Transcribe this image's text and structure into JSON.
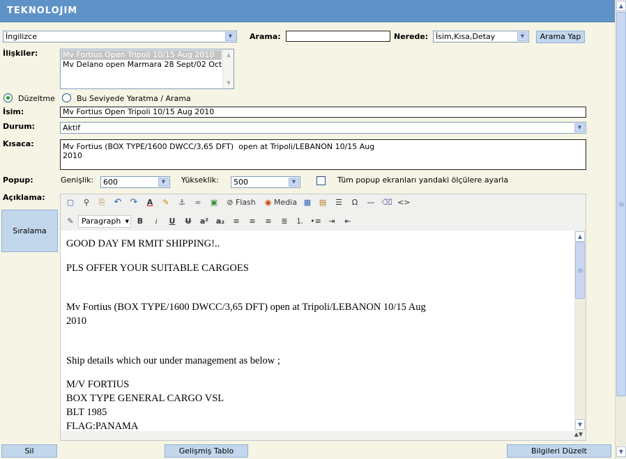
{
  "header": {
    "logo": "TEKNOLOJIM"
  },
  "search": {
    "language_value": "İngilizce",
    "arama_label": "Arama:",
    "arama_value": "",
    "nerede_label": "Nerede:",
    "nerede_value": "İsim,Kısa,Detay",
    "search_button": "Arama Yap"
  },
  "relations": {
    "label": "İlişkiler:",
    "items": [
      {
        "text": "Mv Fortius Open Tripoli 10/15 Aug 2010",
        "selected": true
      },
      {
        "text": "Mv Delano open Marmara 28 Sept/02 Oct",
        "selected": false
      }
    ]
  },
  "mode": {
    "edit_label": "Düzeltme",
    "create_label": "Bu Seviyede Yaratma / Arama",
    "selected": "edit"
  },
  "form": {
    "name_label": "İsim:",
    "name_value": "Mv Fortius Open Tripoli 10/15 Aug 2010",
    "status_label": "Durum:",
    "status_value": "Aktif",
    "summary_label": "Kısaca:",
    "summary_value": "Mv Fortius (BOX TYPE/1600 DWCC/3,65 DFT)  open at Tripoli/LEBANON 10/15 Aug\n2010",
    "popup_label": "Popup:",
    "width_label": "Genişlik:",
    "width_value": "600",
    "height_label": "Yükseklik:",
    "height_value": "500",
    "all_popups_label": "Tüm popup ekranları yandaki ölçülere ayarla",
    "description_label": "Açıklama:"
  },
  "editor": {
    "toolbar_row1": [
      {
        "icon": "preview-icon",
        "glyph": "▢"
      },
      {
        "icon": "find-icon",
        "glyph": "⚲"
      },
      {
        "icon": "paste-icon",
        "glyph": "⎘"
      },
      {
        "icon": "undo-icon",
        "glyph": "↶"
      },
      {
        "icon": "redo-icon",
        "glyph": "↷"
      },
      {
        "icon": "text-color-icon",
        "glyph": "A"
      },
      {
        "icon": "highlight-icon",
        "glyph": "✎"
      },
      {
        "icon": "anchor-icon",
        "glyph": "⚓"
      },
      {
        "icon": "link-icon",
        "glyph": "∞"
      },
      {
        "icon": "image-icon",
        "glyph": "▣"
      }
    ],
    "flash_label": "Flash",
    "media_label": "Media",
    "toolbar_row1_tail": [
      {
        "icon": "table-icon",
        "glyph": "▦"
      },
      {
        "icon": "table-edit-icon",
        "glyph": "▤"
      },
      {
        "icon": "template-icon",
        "glyph": "☰"
      },
      {
        "icon": "special-char-icon",
        "glyph": "Ω"
      },
      {
        "icon": "horizontal-rule-icon",
        "glyph": "—"
      },
      {
        "icon": "eraser-icon",
        "glyph": "⌫"
      },
      {
        "icon": "source-code-icon",
        "glyph": "<>"
      }
    ],
    "format_value": "Paragraph",
    "toolbar_row2": [
      {
        "icon": "bold-icon",
        "glyph": "B"
      },
      {
        "icon": "italic-icon",
        "glyph": "i"
      },
      {
        "icon": "underline-icon",
        "glyph": "U"
      },
      {
        "icon": "strikethrough-icon",
        "glyph": "U"
      },
      {
        "icon": "superscript-icon",
        "glyph": "a²"
      },
      {
        "icon": "subscript-icon",
        "glyph": "a₂"
      },
      {
        "icon": "align-left-icon",
        "glyph": "≡"
      },
      {
        "icon": "align-center-icon",
        "glyph": "≡"
      },
      {
        "icon": "align-right-icon",
        "glyph": "≡"
      },
      {
        "icon": "align-justify-icon",
        "glyph": "≣"
      },
      {
        "icon": "ordered-list-icon",
        "glyph": "⒈"
      },
      {
        "icon": "unordered-list-icon",
        "glyph": "•"
      },
      {
        "icon": "indent-icon",
        "glyph": "⇥"
      },
      {
        "icon": "outdent-icon",
        "glyph": "⇤"
      }
    ],
    "content": [
      "GOOD DAY FM RMIT SHIPPING!..",
      "PLS OFFER YOUR SUITABLE CARGOES",
      "Mv Fortius (BOX TYPE/1600 DWCC/3,65 DFT)  open at Tripoli/LEBANON 10/15 Aug",
      "2010",
      "Ship details which our under management as below ;",
      "M/V FORTIUS",
      "BOX TYPE  GENERAL CARGO VSL",
      "BLT 1985",
      "FLAG:PANAMA"
    ]
  },
  "sidebar": {
    "sort_button": "Sıralama"
  },
  "footer": {
    "delete_button": "Sil",
    "advanced_table_button": "Gelişmiş Tablo",
    "update_button": "Bilgileri Düzelt"
  }
}
